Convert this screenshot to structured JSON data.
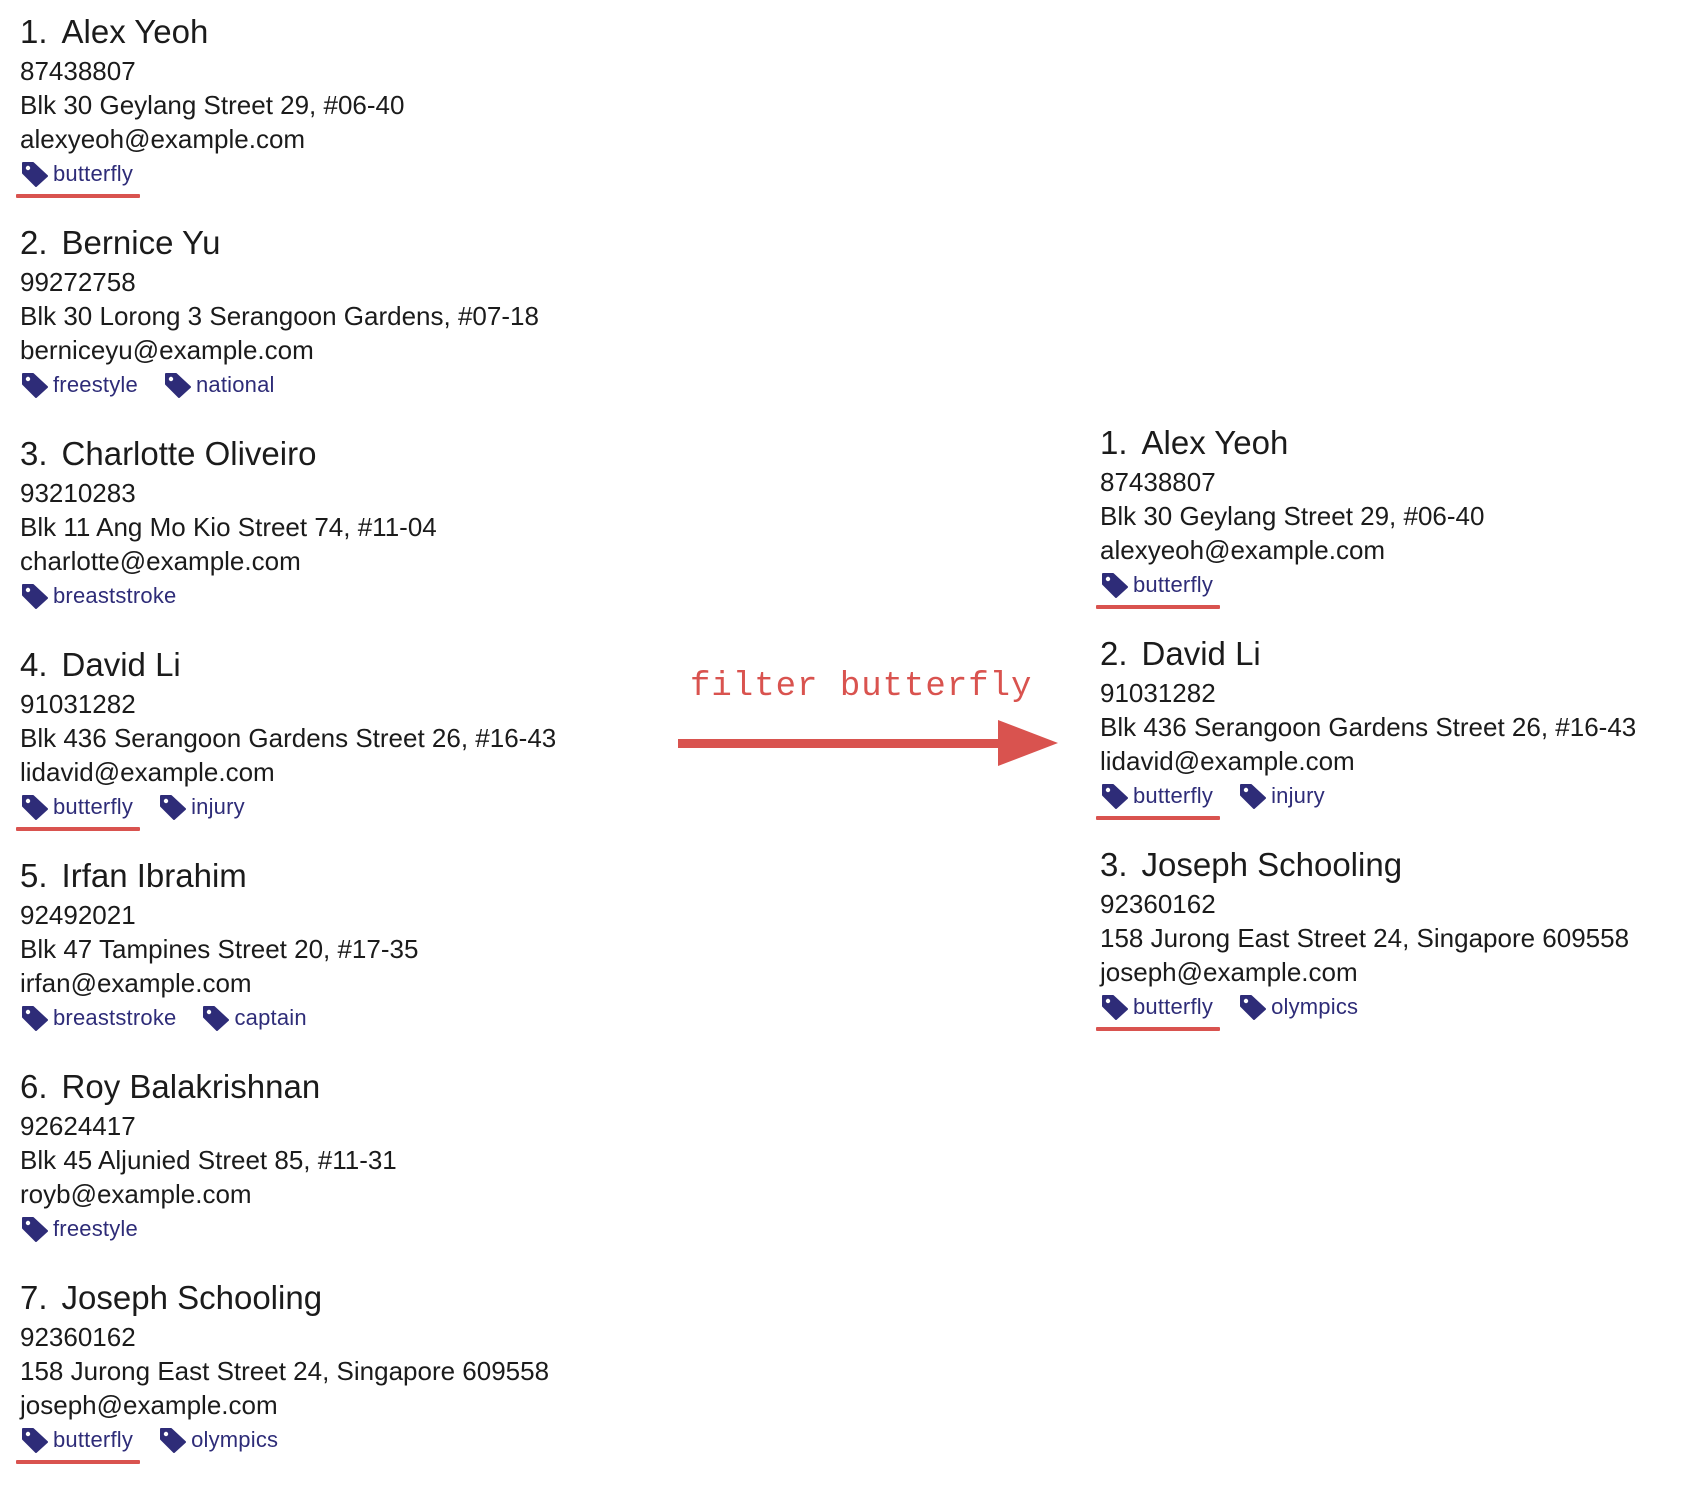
{
  "command": "filter butterfly",
  "colors": {
    "highlight": "#d9534f",
    "tag_text": "#2e2c78",
    "tag_icon": "#2e2c78"
  },
  "icons": {
    "tag": "tag-icon"
  },
  "before": {
    "persons": [
      {
        "index": "1.",
        "name": "Alex Yeoh",
        "phone": "87438807",
        "address": "Blk 30 Geylang Street 29, #06-40",
        "email": "alexyeoh@example.com",
        "tags": [
          {
            "label": "butterfly",
            "highlighted": true
          }
        ]
      },
      {
        "index": "2.",
        "name": "Bernice Yu",
        "phone": "99272758",
        "address": "Blk 30 Lorong 3 Serangoon Gardens, #07-18",
        "email": "berniceyu@example.com",
        "tags": [
          {
            "label": "freestyle",
            "highlighted": false
          },
          {
            "label": "national",
            "highlighted": false
          }
        ]
      },
      {
        "index": "3.",
        "name": "Charlotte Oliveiro",
        "phone": "93210283",
        "address": "Blk 11 Ang Mo Kio Street 74, #11-04",
        "email": "charlotte@example.com",
        "tags": [
          {
            "label": "breaststroke",
            "highlighted": false
          }
        ]
      },
      {
        "index": "4.",
        "name": "David Li",
        "phone": "91031282",
        "address": "Blk 436 Serangoon Gardens Street 26, #16-43",
        "email": "lidavid@example.com",
        "tags": [
          {
            "label": "butterfly",
            "highlighted": true
          },
          {
            "label": "injury",
            "highlighted": false
          }
        ]
      },
      {
        "index": "5.",
        "name": "Irfan Ibrahim",
        "phone": "92492021",
        "address": "Blk 47 Tampines Street 20, #17-35",
        "email": "irfan@example.com",
        "tags": [
          {
            "label": "breaststroke",
            "highlighted": false
          },
          {
            "label": "captain",
            "highlighted": false
          }
        ]
      },
      {
        "index": "6.",
        "name": "Roy Balakrishnan",
        "phone": "92624417",
        "address": "Blk 45 Aljunied Street 85, #11-31",
        "email": "royb@example.com",
        "tags": [
          {
            "label": "freestyle",
            "highlighted": false
          }
        ]
      },
      {
        "index": "7.",
        "name": "Joseph Schooling",
        "phone": "92360162",
        "address": "158 Jurong East Street 24, Singapore 609558",
        "email": "joseph@example.com",
        "tags": [
          {
            "label": "butterfly",
            "highlighted": true
          },
          {
            "label": "olympics",
            "highlighted": false
          }
        ]
      }
    ]
  },
  "after": {
    "persons": [
      {
        "index": "1.",
        "name": "Alex Yeoh",
        "phone": "87438807",
        "address": "Blk 30 Geylang Street 29, #06-40",
        "email": "alexyeoh@example.com",
        "tags": [
          {
            "label": "butterfly",
            "highlighted": true
          }
        ]
      },
      {
        "index": "2.",
        "name": "David Li",
        "phone": "91031282",
        "address": "Blk 436 Serangoon Gardens Street 26, #16-43",
        "email": "lidavid@example.com",
        "tags": [
          {
            "label": "butterfly",
            "highlighted": true
          },
          {
            "label": "injury",
            "highlighted": false
          }
        ]
      },
      {
        "index": "3.",
        "name": "Joseph Schooling",
        "phone": "92360162",
        "address": "158 Jurong East Street 24, Singapore 609558",
        "email": "joseph@example.com",
        "tags": [
          {
            "label": "butterfly",
            "highlighted": true
          },
          {
            "label": "olympics",
            "highlighted": false
          }
        ]
      }
    ]
  }
}
